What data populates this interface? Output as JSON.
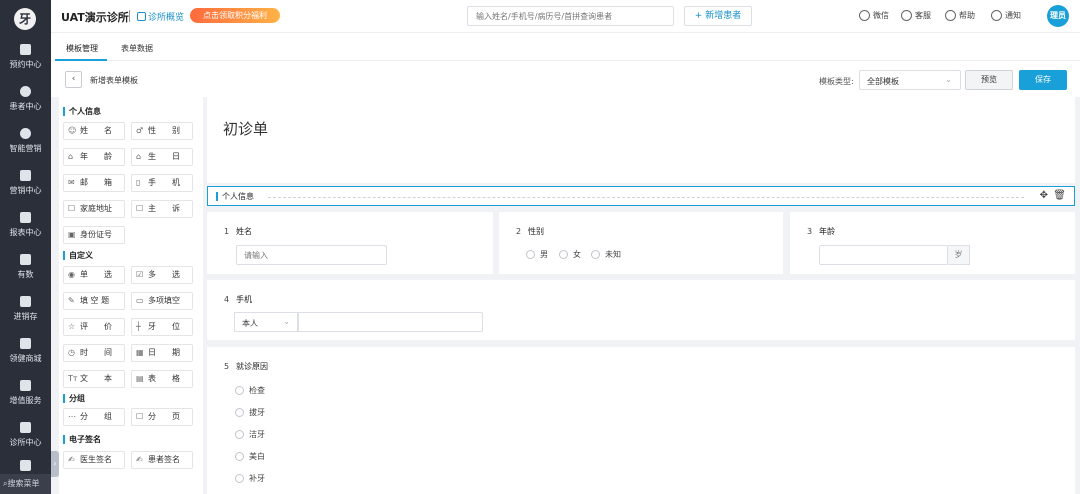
{
  "sidebar": {
    "logo": "牙",
    "items": [
      {
        "label": "预约中心",
        "icon": "calendar-icon"
      },
      {
        "label": "患者中心",
        "icon": "user-icon"
      },
      {
        "label": "智能营销",
        "icon": "lightbulb-icon"
      },
      {
        "label": "营销中心",
        "icon": "grid-icon"
      },
      {
        "label": "报表中心",
        "icon": "bar-chart-icon"
      },
      {
        "label": "有数",
        "icon": "line-chart-icon"
      },
      {
        "label": "进销存",
        "icon": "layers-icon"
      },
      {
        "label": "领健商城",
        "icon": "store-icon"
      },
      {
        "label": "增值服务",
        "icon": "apps-icon"
      },
      {
        "label": "诊所中心",
        "icon": "clinic-icon"
      },
      {
        "label": "",
        "icon": "settings-icon"
      }
    ],
    "bottom_search": "搜索菜单",
    "collapse": "›"
  },
  "topbar": {
    "clinic_name": "UAT演示诊所",
    "overview_link": "诊所概览",
    "promo_banner": "点击领取积分福利",
    "search_placeholder": "输入姓名/手机号/病历号/首拼查询患者",
    "new_patient": "+ 新增患者",
    "wechat": "微信",
    "service": "客服",
    "help": "帮助",
    "notify": "通知",
    "user": "理员"
  },
  "tabs": [
    {
      "label": "模板管理",
      "active": true
    },
    {
      "label": "表单数据",
      "active": false
    }
  ],
  "toolbar": {
    "back": "‹",
    "title": "新增表单模板",
    "template_type_label": "模板类型:",
    "template_type_value": "全部模板",
    "preview": "预览",
    "save": "保存"
  },
  "palette": {
    "groups": [
      {
        "title": "个人信息",
        "fields": [
          {
            "glyph": "☺",
            "label": "姓　　名"
          },
          {
            "glyph": "♂",
            "label": "性　　别"
          },
          {
            "glyph": "⌂",
            "label": "年　　龄"
          },
          {
            "glyph": "⌂",
            "label": "生　　日"
          },
          {
            "glyph": "✉",
            "label": "邮　　箱"
          },
          {
            "glyph": "▯",
            "label": "手　　机"
          },
          {
            "glyph": "☐",
            "label": "家庭地址"
          },
          {
            "glyph": "☐",
            "label": "主　　诉"
          },
          {
            "glyph": "▣",
            "label": "身份证号"
          }
        ]
      },
      {
        "title": "自定义",
        "fields": [
          {
            "glyph": "◉",
            "label": "单　　选"
          },
          {
            "glyph": "☑",
            "label": "多　　选"
          },
          {
            "glyph": "✎",
            "label": "填 空 题"
          },
          {
            "glyph": "▭",
            "label": "多项填空"
          },
          {
            "glyph": "☆",
            "label": "评　　价"
          },
          {
            "glyph": "┼",
            "label": "牙　　位"
          },
          {
            "glyph": "◷",
            "label": "时　　间"
          },
          {
            "glyph": "▦",
            "label": "日　　期"
          },
          {
            "glyph": "Tᴛ",
            "label": "文　　本"
          },
          {
            "glyph": "▤",
            "label": "表　　格"
          }
        ]
      },
      {
        "title": "分组",
        "fields": [
          {
            "glyph": "⋯",
            "label": "分　　组"
          },
          {
            "glyph": "☐",
            "label": "分　　页"
          }
        ]
      },
      {
        "title": "电子签名",
        "fields": [
          {
            "glyph": "✍",
            "label": "医生签名"
          },
          {
            "glyph": "✍",
            "label": "患者签名"
          }
        ]
      }
    ]
  },
  "form": {
    "title": "初诊单",
    "section": "个人信息",
    "q1": {
      "num": "1",
      "label": "姓名",
      "placeholder": "请输入"
    },
    "q2": {
      "num": "2",
      "label": "性别",
      "options": [
        "男",
        "女",
        "未知"
      ]
    },
    "q3": {
      "num": "3",
      "label": "年龄",
      "unit": "岁"
    },
    "q4": {
      "num": "4",
      "label": "手机",
      "prefix": "本人"
    },
    "q5": {
      "num": "5",
      "label": "就诊原因",
      "options": [
        "检查",
        "拔牙",
        "洁牙",
        "美白",
        "补牙"
      ]
    }
  }
}
